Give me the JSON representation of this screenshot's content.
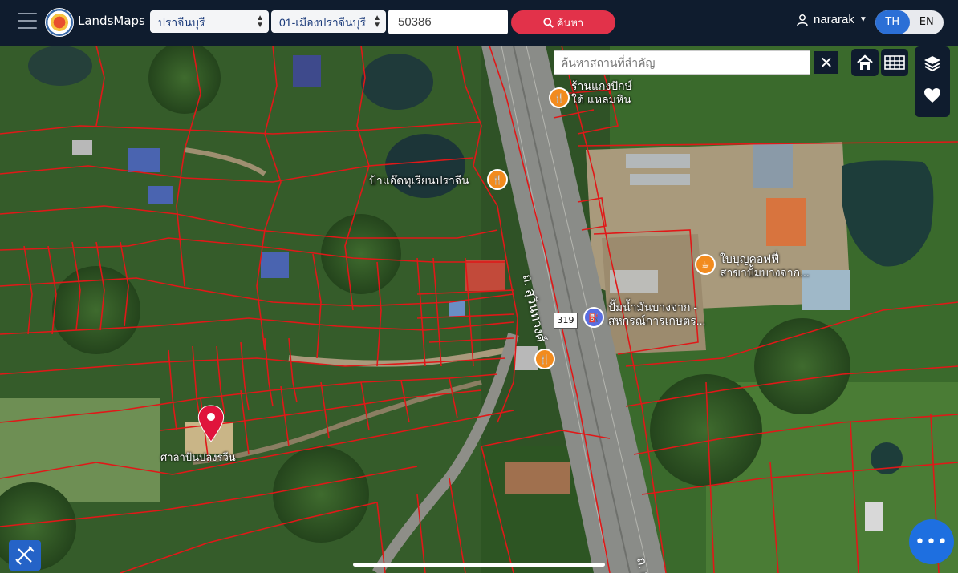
{
  "header": {
    "brand": "LandsMaps",
    "province_select": "ปราจีนบุรี",
    "district_select": "01-เมืองปราจีนบุรี",
    "deed_number": "50386",
    "search_label": "ค้นหา",
    "username": "nararak",
    "lang_th": "TH",
    "lang_en": "EN",
    "active_lang": "TH"
  },
  "map": {
    "place_search_placeholder": "ค้นหาสถานที่สำคัญ",
    "labels": {
      "poi_top": "ร้านแกงปักษ์\nใต้ แหลมหิน",
      "poi_restaurant": "ป้าแอ๊ดทุเรียนปราจีน",
      "poi_coffee": "ใบบุญคอฟฟี่\nสาขาปั้มบางจาก...",
      "poi_gas": "ปั๊มน้ำมันบางจาก -\nสหกรณ์การเกษตร...",
      "road_name": "ถ. สุวินทวงศ์",
      "road_number": "319",
      "marker_label": "ศาลาปันปลงรวีน",
      "road_bottom": "ถ. สุ"
    },
    "icons": {
      "home": "home-icon",
      "grid": "grid-icon",
      "layers": "layers-icon",
      "favorite": "heart-icon",
      "tools": "ruler-tools-icon",
      "more": "more-dots-icon",
      "marker": "map-pin-icon"
    },
    "colors": {
      "parcel_lines": "#e01818",
      "marker": "#e0143c",
      "accent": "#2b6fd6"
    }
  }
}
